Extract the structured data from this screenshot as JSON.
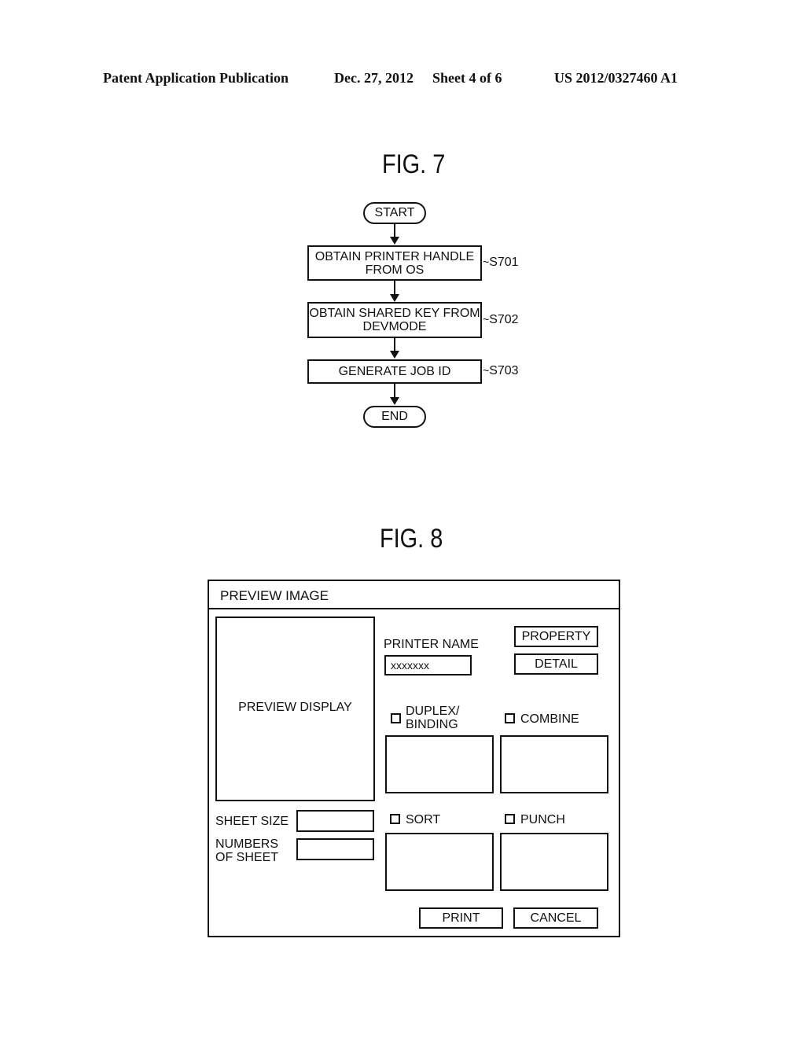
{
  "header": {
    "publication": "Patent Application Publication",
    "date": "Dec. 27, 2012",
    "sheet": "Sheet 4 of 6",
    "number": "US 2012/0327460 A1"
  },
  "fig7": {
    "title": "FIG. 7",
    "start": "START",
    "end": "END",
    "steps": [
      {
        "text_line1": "OBTAIN PRINTER HANDLE",
        "text_line2": "FROM OS",
        "label": "S701"
      },
      {
        "text_line1": "OBTAIN SHARED KEY FROM",
        "text_line2": "DEVMODE",
        "label": "S702"
      },
      {
        "text_line1": "GENERATE JOB ID",
        "text_line2": "",
        "label": "S703"
      }
    ],
    "tilde": "~"
  },
  "fig8": {
    "title": "FIG. 8",
    "dialog_title": "PREVIEW IMAGE",
    "preview_display": "PREVIEW DISPLAY",
    "printer_name_label": "PRINTER NAME",
    "printer_name_value": "xxxxxxx",
    "property_button": "PROPERTY",
    "detail_button": "DETAIL",
    "options": {
      "duplex_line1": "DUPLEX/",
      "duplex_line2": "BINDING",
      "combine": "COMBINE",
      "sort": "SORT",
      "punch": "PUNCH"
    },
    "sheet_size_label": "SHEET SIZE",
    "numbers_of_sheet_line1": "NUMBERS",
    "numbers_of_sheet_line2": "OF SHEET",
    "print_button": "PRINT",
    "cancel_button": "CANCEL"
  }
}
